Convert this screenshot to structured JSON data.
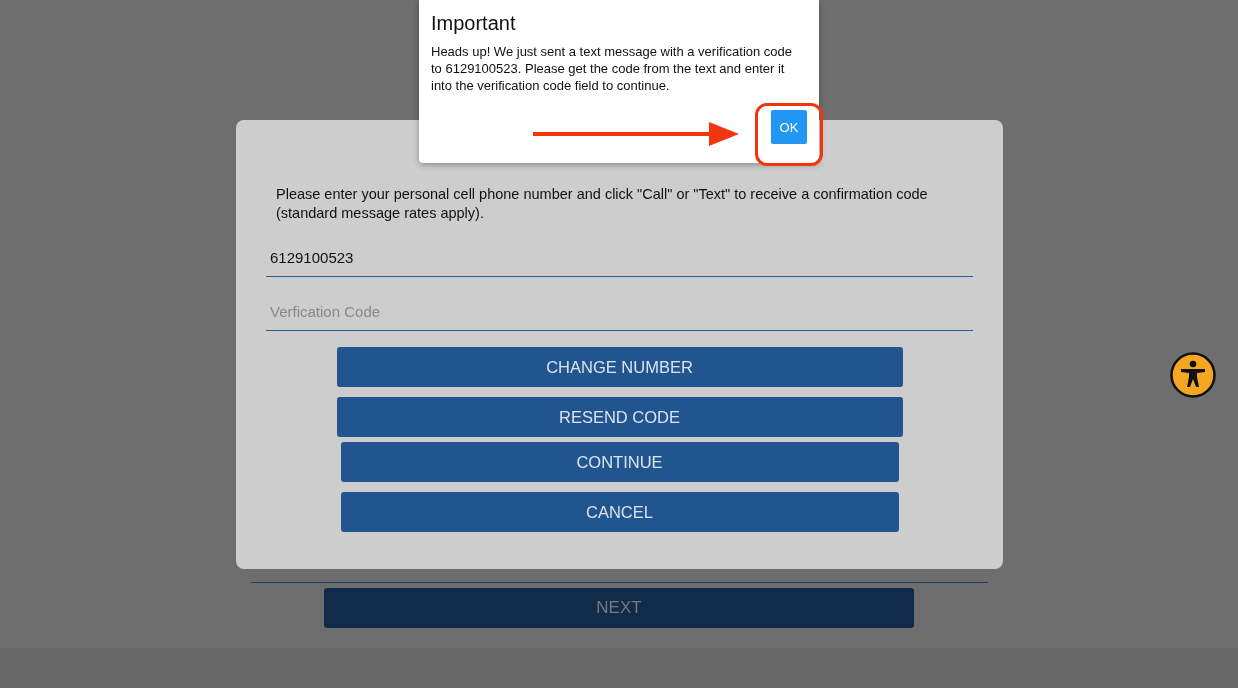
{
  "page": {
    "next_button": "NEXT"
  },
  "modal": {
    "instructions": "Please enter your personal cell phone number and click \"Call\" or \"Text\" to receive a confirmation code (standard message rates apply).",
    "phone_field": {
      "value": "6129100523"
    },
    "code_field": {
      "placeholder": "Verfication Code"
    },
    "buttons": [
      "CHANGE NUMBER",
      "RESEND CODE",
      "CONTINUE",
      "CANCEL"
    ]
  },
  "alert": {
    "title": "Important",
    "message": "Heads up! We just sent a text message with a verification code to 6129100523. Please get the code from the text and enter it into the verification code field to continue.",
    "ok_button": "OK"
  }
}
